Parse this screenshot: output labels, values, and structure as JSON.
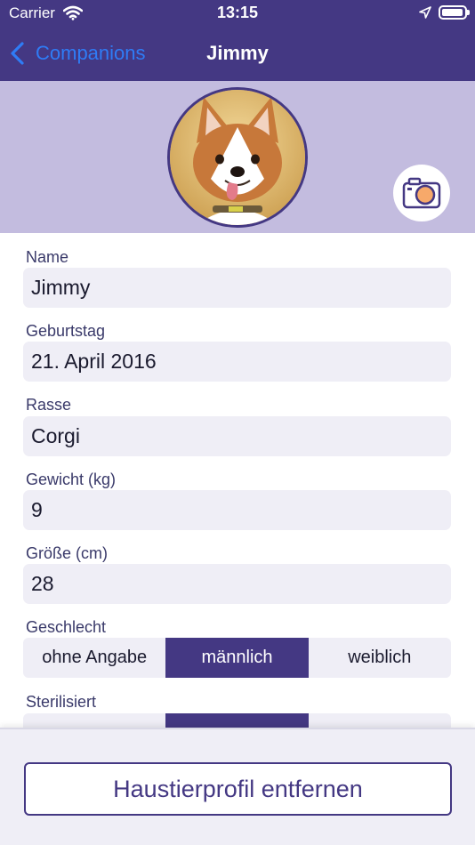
{
  "status_bar": {
    "carrier": "Carrier",
    "time": "13:15"
  },
  "nav": {
    "back_label": "Companions",
    "title": "Jimmy"
  },
  "colors": {
    "primary": "#443883",
    "header_bg": "#c3bcdf",
    "link": "#2f7cf6",
    "field_bg": "#efeef6"
  },
  "header": {
    "avatar_icon": "dog-photo",
    "camera_icon": "camera-icon"
  },
  "form": {
    "name": {
      "label": "Name",
      "value": "Jimmy"
    },
    "birthday": {
      "label": "Geburtstag",
      "value": "21. April 2016"
    },
    "breed": {
      "label": "Rasse",
      "value": "Corgi"
    },
    "weight": {
      "label": "Gewicht (kg)",
      "value": "9"
    },
    "height": {
      "label": "Größe (cm)",
      "value": "28"
    },
    "gender": {
      "label": "Geschlecht",
      "options": [
        "ohne Angabe",
        "männlich",
        "weiblich"
      ],
      "selected": "männlich"
    },
    "neutered": {
      "label": "Sterilisiert"
    }
  },
  "footer": {
    "remove_label": "Haustierprofil entfernen"
  }
}
